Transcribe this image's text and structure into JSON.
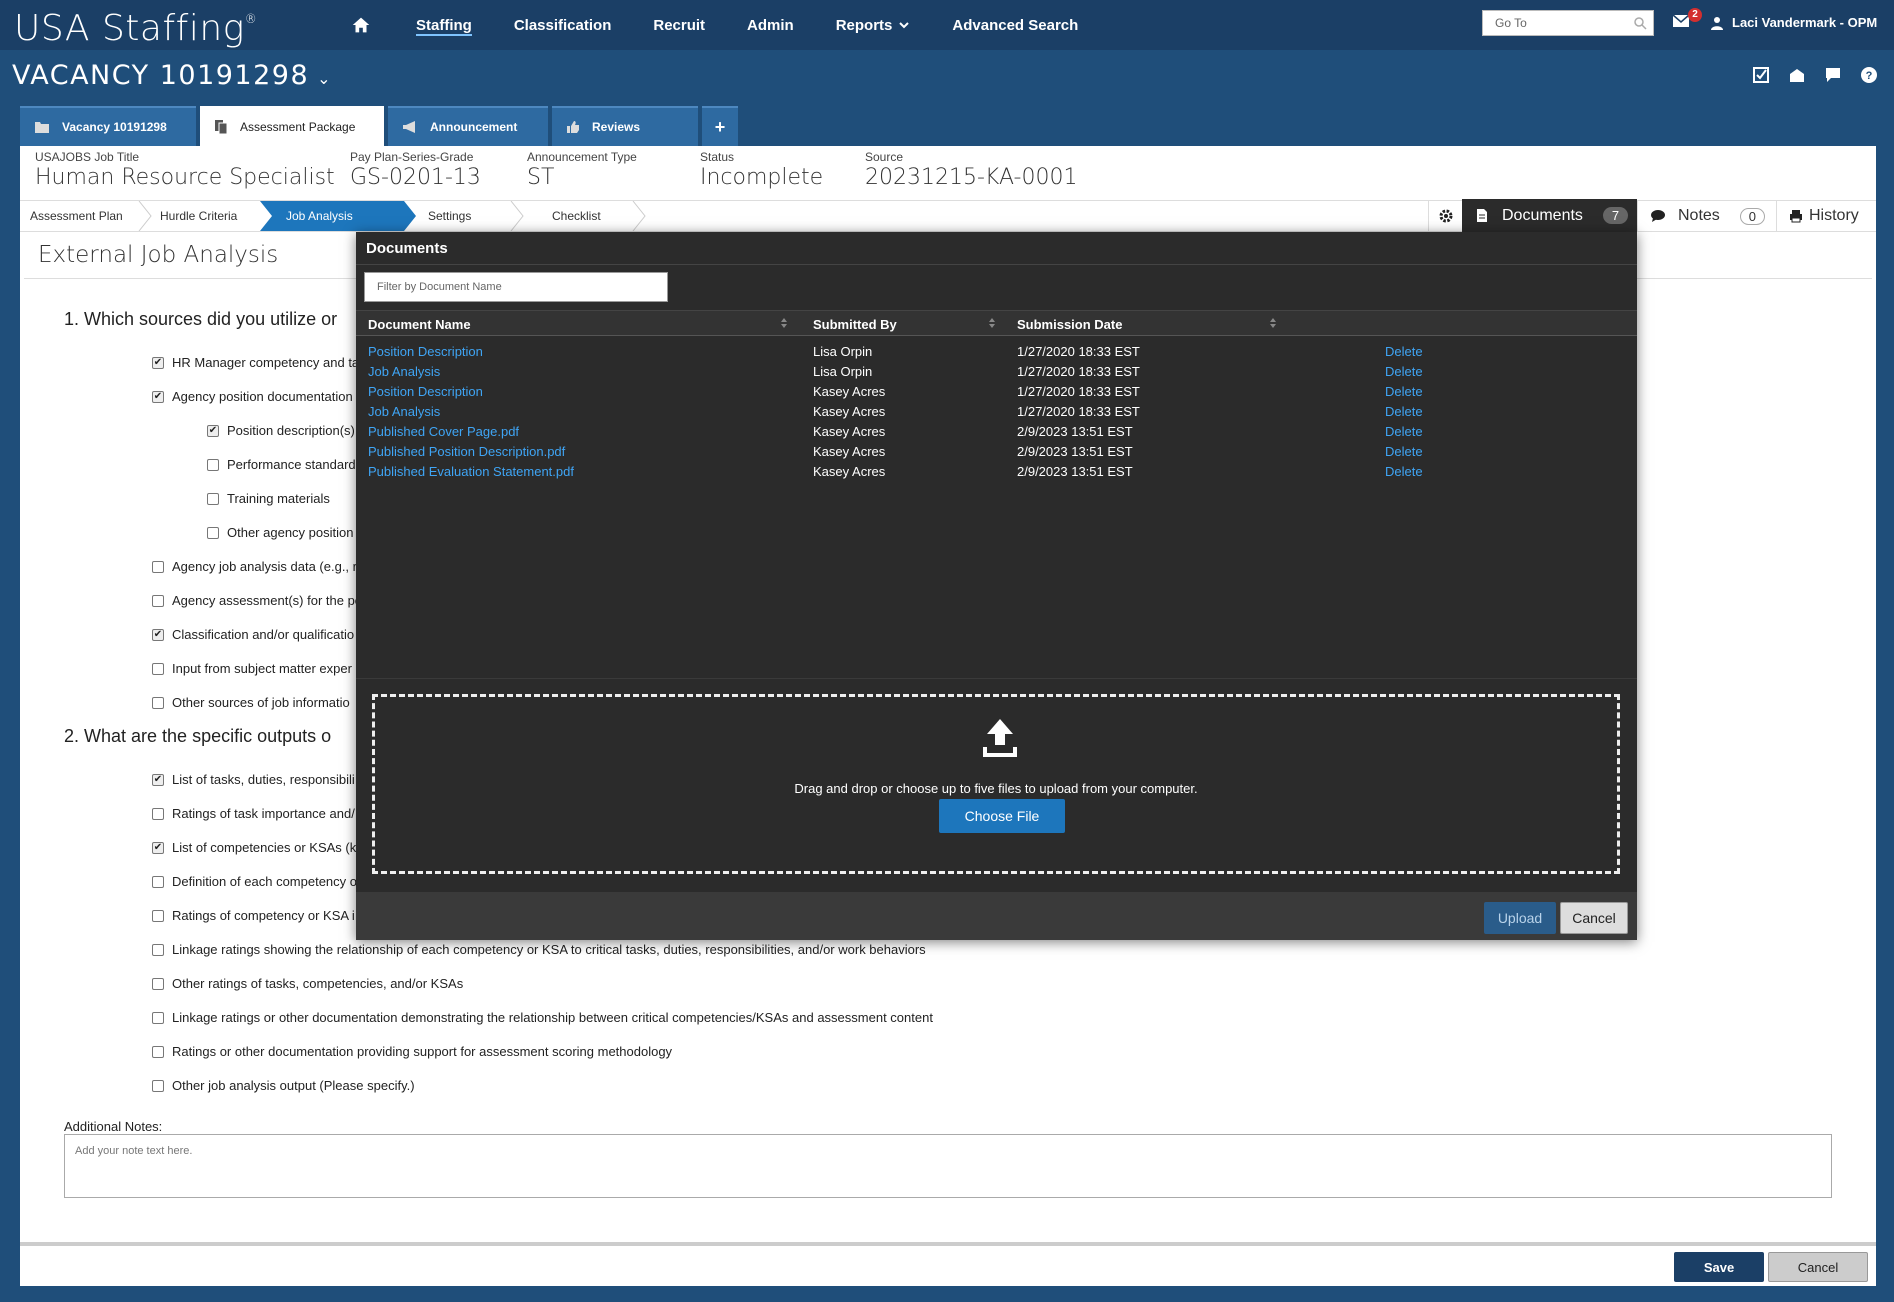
{
  "app": {
    "logo_text": "USA Staffing",
    "logo_mark": "®"
  },
  "nav": {
    "items": [
      "Staffing",
      "Classification",
      "Recruit",
      "Admin",
      "Reports",
      "Advanced Search"
    ],
    "active": "Staffing",
    "goto_placeholder": "Go To",
    "mail_count": "2",
    "user_name": "Laci Vandermark - OPM"
  },
  "vacancy": {
    "title": "VACANCY 10191298"
  },
  "tabs": [
    {
      "label": "Vacancy 10191298",
      "icon": "folder-icon"
    },
    {
      "label": "Assessment Package",
      "icon": "copy-icon"
    },
    {
      "label": "Announcement",
      "icon": "megaphone-icon"
    },
    {
      "label": "Reviews",
      "icon": "thumbs-up-icon"
    }
  ],
  "info": {
    "job_title_label": "USAJOBS Job Title",
    "job_title": "Human Resource Specialist",
    "pay_label": "Pay Plan-Series-Grade",
    "pay": "GS-0201-13",
    "ann_type_label": "Announcement Type",
    "ann_type": "ST",
    "status_label": "Status",
    "status": "Incomplete",
    "source_label": "Source",
    "source": "20231215-KA-0001"
  },
  "steps": [
    "Assessment Plan",
    "Hurdle Criteria",
    "Job Analysis",
    "Settings",
    "Checklist"
  ],
  "side_tabs": {
    "documents": "Documents",
    "documents_count": "7",
    "notes": "Notes",
    "notes_count": "0",
    "history": "History"
  },
  "form": {
    "title": "External Job Analysis",
    "q1": "1. Which sources did you utilize or",
    "q1_options": [
      {
        "label": "HR Manager competency and ta",
        "checked": true
      },
      {
        "label": "Agency position documentation",
        "checked": true
      },
      {
        "label": "Position description(s)",
        "checked": true
      },
      {
        "label": "Performance standard",
        "checked": false
      },
      {
        "label": "Training materials",
        "checked": false
      },
      {
        "label": "Other agency position",
        "checked": false
      },
      {
        "label": "Agency job analysis data (e.g., ra",
        "checked": false
      },
      {
        "label": "Agency assessment(s) for the po",
        "checked": false
      },
      {
        "label": "Classification and/or qualificatio",
        "checked": true
      },
      {
        "label": "Input from subject matter exper",
        "checked": false
      },
      {
        "label": "Other sources of job informatio",
        "checked": false
      }
    ],
    "q2": "2. What are the specific outputs o",
    "q2_options": [
      {
        "label": "List of tasks, duties, responsibili",
        "checked": true
      },
      {
        "label": "Ratings of task importance and/",
        "checked": false
      },
      {
        "label": "List of competencies or KSAs (k",
        "checked": true
      },
      {
        "label": "Definition of each competency o",
        "checked": false
      },
      {
        "label": "Ratings of competency or KSA i",
        "checked": false
      },
      {
        "label": "Linkage ratings showing the relationship of each competency or KSA to critical tasks, duties, responsibilities, and/or work behaviors",
        "checked": false
      },
      {
        "label": "Other ratings of tasks, competencies, and/or KSAs",
        "checked": false
      },
      {
        "label": "Linkage ratings or other documentation demonstrating the relationship between critical competencies/KSAs and assessment content",
        "checked": false
      },
      {
        "label": "Ratings or other documentation providing support for assessment scoring methodology",
        "checked": false
      },
      {
        "label": "Other job analysis output (Please specify.)",
        "checked": false
      }
    ],
    "notes_label": "Additional Notes:",
    "notes_placeholder": "Add your note text here.",
    "save": "Save",
    "cancel": "Cancel"
  },
  "modal": {
    "title": "Documents",
    "filter_placeholder": "Filter by Document Name",
    "columns": [
      "Document Name",
      "Submitted By",
      "Submission Date"
    ],
    "rows": [
      {
        "name": "Position Description",
        "by": "Lisa Orpin",
        "date": "1/27/2020 18:33 EST",
        "action": "Delete"
      },
      {
        "name": "Job Analysis",
        "by": "Lisa Orpin",
        "date": "1/27/2020 18:33 EST",
        "action": "Delete"
      },
      {
        "name": "Position Description",
        "by": "Kasey Acres",
        "date": "1/27/2020 18:33 EST",
        "action": "Delete"
      },
      {
        "name": "Job Analysis",
        "by": "Kasey Acres",
        "date": "1/27/2020 18:33 EST",
        "action": "Delete"
      },
      {
        "name": "Published Cover Page.pdf",
        "by": "Kasey Acres",
        "date": "2/9/2023 13:51 EST",
        "action": "Delete"
      },
      {
        "name": "Published Position Description.pdf",
        "by": "Kasey Acres",
        "date": "2/9/2023 13:51 EST",
        "action": "Delete"
      },
      {
        "name": "Published Evaluation Statement.pdf",
        "by": "Kasey Acres",
        "date": "2/9/2023 13:51 EST",
        "action": "Delete"
      }
    ],
    "drop_text": "Drag and drop or choose up to five files to upload from your computer.",
    "choose_file": "Choose File",
    "upload": "Upload",
    "cancel": "Cancel"
  },
  "colors": {
    "nav_bg": "#1b3f66",
    "accent": "#1d76bc",
    "link": "#3fa5f5",
    "modal_bg": "#2b2b2b"
  }
}
